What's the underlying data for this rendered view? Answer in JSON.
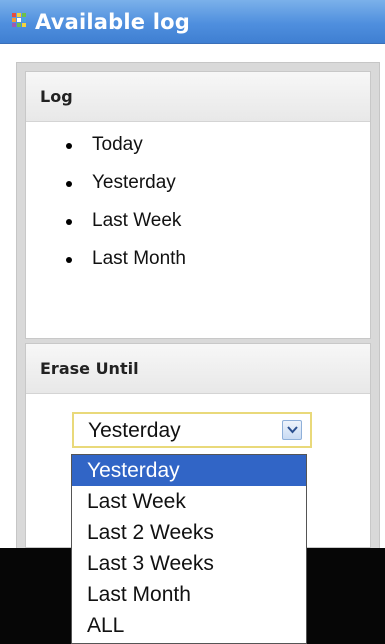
{
  "window": {
    "title": "Available log",
    "icon": "grid-app-icon",
    "title_bar_color": "#4f8fde"
  },
  "log_panel": {
    "header": "Log",
    "items": [
      "Today",
      "Yesterday",
      "Last Week",
      "Last Month"
    ]
  },
  "erase_panel": {
    "header": "Erase Until",
    "select": {
      "value": "Yesterday",
      "arrow_icon": "chevron-down-icon",
      "options": [
        "Yesterday",
        "Last Week",
        "Last 2 Weeks",
        "Last 3 Weeks",
        "Last Month",
        "ALL"
      ],
      "highlighted_option": "Yesterday",
      "highlight_color": "#3165c6"
    }
  }
}
